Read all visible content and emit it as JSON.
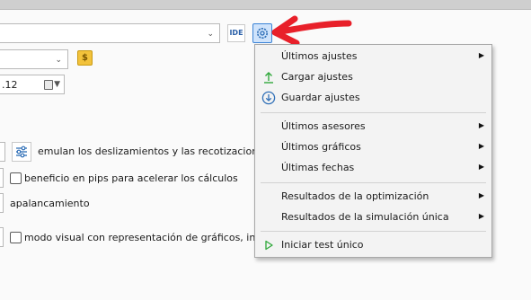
{
  "toolbar": {
    "ide_label": "IDE",
    "coin_label": "$"
  },
  "form": {
    "date_value": ".12",
    "row1_text": "emulan los deslizamientos y las recotizaciones al ej",
    "row2_text": "beneficio en pips para acelerar los cálculos",
    "row3_text": "apalancamiento",
    "row4_text": "modo visual con representación de gráficos, indicador"
  },
  "menu": {
    "items": [
      {
        "label": "Últimos ajustes",
        "submenu": true
      },
      {
        "label": "Cargar ajustes",
        "icon": "upload-arrow-icon"
      },
      {
        "label": "Guardar ajustes",
        "icon": "download-circle-icon"
      },
      {
        "label": "Últimos asesores",
        "submenu": true
      },
      {
        "label": "Últimos gráficos",
        "submenu": true
      },
      {
        "label": "Últimas fechas",
        "submenu": true
      },
      {
        "label": "Resultados de la optimización",
        "submenu": true
      },
      {
        "label": "Resultados de la simulación única",
        "submenu": true
      },
      {
        "label": "Iniciar test único",
        "icon": "play-icon"
      }
    ]
  },
  "colors": {
    "accent": "#3b83d6",
    "annotation": "#e8202a",
    "play": "#2fa83a"
  }
}
